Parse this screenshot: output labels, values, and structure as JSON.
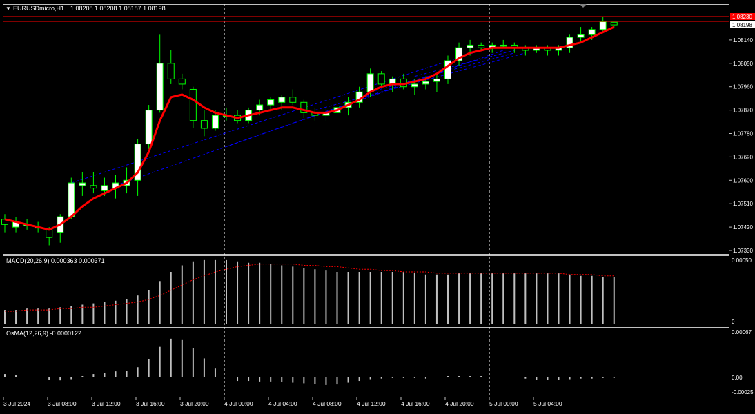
{
  "header": {
    "symbol_label": "EURUSDmicro,H1",
    "ohlc": "1.08208 1.08208 1.08187 1.08198"
  },
  "price_axis": {
    "labels": [
      "1.08230",
      "1.08198",
      "1.08140",
      "1.08050",
      "1.07960",
      "1.07870",
      "1.07780",
      "1.07690",
      "1.07600",
      "1.07510",
      "1.07420",
      "1.07330"
    ],
    "current_price": "1.08198",
    "top_line_price": "1.08230",
    "line_color": "#ff0000"
  },
  "time_axis": {
    "labels": [
      "3 Jul 2024",
      "3 Jul 08:00",
      "3 Jul 12:00",
      "3 Jul 16:00",
      "3 Jul 20:00",
      "4 Jul 00:00",
      "4 Jul 04:00",
      "4 Jul 08:00",
      "4 Jul 12:00",
      "4 Jul 16:00",
      "4 Jul 20:00",
      "5 Jul 00:00",
      "5 Jul 04:00"
    ]
  },
  "macd": {
    "label": "MACD(20,26,9) 0.000363 0.000371",
    "axis_labels": [
      "0.00050",
      "0"
    ]
  },
  "osma": {
    "label": "OsMA(12,26,9) -0.0000122",
    "axis_labels": [
      "0.00067",
      "0.00",
      "-0.00025"
    ]
  },
  "colors": {
    "background": "#000000",
    "bull_candle": "#ffffff",
    "bear_candle": "#000000",
    "candle_outline": "#00ff00",
    "moving_average": "#ff0000",
    "trend_lines": "#0000ff",
    "macd_signal": "#ff0000",
    "histogram": "#c0c0c0"
  },
  "chart_data": [
    {
      "type": "candlestick",
      "title": "EURUSDmicro,H1",
      "ylim": [
        1.0729,
        1.0825
      ],
      "candles": [
        {
          "o": 1.0745,
          "h": 1.0747,
          "l": 1.074,
          "c": 1.0743
        },
        {
          "o": 1.0742,
          "h": 1.0746,
          "l": 1.074,
          "c": 1.0744
        },
        {
          "o": 1.0743,
          "h": 1.0745,
          "l": 1.0741,
          "c": 1.0743
        },
        {
          "o": 1.0742,
          "h": 1.0744,
          "l": 1.074,
          "c": 1.0742
        },
        {
          "o": 1.0741,
          "h": 1.0742,
          "l": 1.0735,
          "c": 1.0738
        },
        {
          "o": 1.074,
          "h": 1.0747,
          "l": 1.0736,
          "c": 1.0746
        },
        {
          "o": 1.0746,
          "h": 1.0761,
          "l": 1.0745,
          "c": 1.0759
        },
        {
          "o": 1.0758,
          "h": 1.0763,
          "l": 1.0754,
          "c": 1.0759
        },
        {
          "o": 1.0758,
          "h": 1.0763,
          "l": 1.0755,
          "c": 1.0757
        },
        {
          "o": 1.0756,
          "h": 1.0761,
          "l": 1.0754,
          "c": 1.0758
        },
        {
          "o": 1.0757,
          "h": 1.0762,
          "l": 1.0753,
          "c": 1.0759
        },
        {
          "o": 1.0758,
          "h": 1.0765,
          "l": 1.0755,
          "c": 1.076
        },
        {
          "o": 1.076,
          "h": 1.0776,
          "l": 1.0754,
          "c": 1.0774
        },
        {
          "o": 1.0774,
          "h": 1.0789,
          "l": 1.0772,
          "c": 1.0787
        },
        {
          "o": 1.0787,
          "h": 1.0816,
          "l": 1.0786,
          "c": 1.0805
        },
        {
          "o": 1.0805,
          "h": 1.081,
          "l": 1.0797,
          "c": 1.0799
        },
        {
          "o": 1.0799,
          "h": 1.0801,
          "l": 1.0795,
          "c": 1.0797
        },
        {
          "o": 1.0795,
          "h": 1.0796,
          "l": 1.078,
          "c": 1.0783
        },
        {
          "o": 1.0783,
          "h": 1.0787,
          "l": 1.0777,
          "c": 1.078
        },
        {
          "o": 1.078,
          "h": 1.0787,
          "l": 1.0779,
          "c": 1.0785
        },
        {
          "o": 1.0785,
          "h": 1.0788,
          "l": 1.0783,
          "c": 1.0785
        },
        {
          "o": 1.0785,
          "h": 1.0787,
          "l": 1.0782,
          "c": 1.0783
        },
        {
          "o": 1.0783,
          "h": 1.0788,
          "l": 1.0782,
          "c": 1.0787
        },
        {
          "o": 1.0787,
          "h": 1.0791,
          "l": 1.0785,
          "c": 1.0789
        },
        {
          "o": 1.0789,
          "h": 1.0792,
          "l": 1.0787,
          "c": 1.0791
        },
        {
          "o": 1.079,
          "h": 1.0793,
          "l": 1.0787,
          "c": 1.0792
        },
        {
          "o": 1.0792,
          "h": 1.0795,
          "l": 1.0789,
          "c": 1.079
        },
        {
          "o": 1.079,
          "h": 1.0791,
          "l": 1.0784,
          "c": 1.0786
        },
        {
          "o": 1.0786,
          "h": 1.0788,
          "l": 1.0783,
          "c": 1.0785
        },
        {
          "o": 1.0785,
          "h": 1.0788,
          "l": 1.0783,
          "c": 1.0786
        },
        {
          "o": 1.0786,
          "h": 1.079,
          "l": 1.0784,
          "c": 1.0788
        },
        {
          "o": 1.0788,
          "h": 1.0792,
          "l": 1.0785,
          "c": 1.079
        },
        {
          "o": 1.079,
          "h": 1.0796,
          "l": 1.0788,
          "c": 1.0794
        },
        {
          "o": 1.0794,
          "h": 1.0803,
          "l": 1.0792,
          "c": 1.0801
        },
        {
          "o": 1.0801,
          "h": 1.0802,
          "l": 1.0796,
          "c": 1.0797
        },
        {
          "o": 1.0797,
          "h": 1.08,
          "l": 1.0794,
          "c": 1.0799
        },
        {
          "o": 1.0799,
          "h": 1.0801,
          "l": 1.0795,
          "c": 1.0796
        },
        {
          "o": 1.0796,
          "h": 1.0799,
          "l": 1.0793,
          "c": 1.0797
        },
        {
          "o": 1.0797,
          "h": 1.08,
          "l": 1.0795,
          "c": 1.0798
        },
        {
          "o": 1.0798,
          "h": 1.0801,
          "l": 1.0794,
          "c": 1.0799
        },
        {
          "o": 1.0799,
          "h": 1.0808,
          "l": 1.0797,
          "c": 1.0806
        },
        {
          "o": 1.0806,
          "h": 1.0813,
          "l": 1.0804,
          "c": 1.0811
        },
        {
          "o": 1.0811,
          "h": 1.0814,
          "l": 1.0808,
          "c": 1.0812
        },
        {
          "o": 1.0812,
          "h": 1.0813,
          "l": 1.081,
          "c": 1.0811
        },
        {
          "o": 1.0811,
          "h": 1.0813,
          "l": 1.0809,
          "c": 1.0812
        },
        {
          "o": 1.0812,
          "h": 1.0814,
          "l": 1.0811,
          "c": 1.0812
        },
        {
          "o": 1.0812,
          "h": 1.0813,
          "l": 1.0809,
          "c": 1.0811
        },
        {
          "o": 1.0811,
          "h": 1.0812,
          "l": 1.0808,
          "c": 1.081
        },
        {
          "o": 1.081,
          "h": 1.0812,
          "l": 1.0809,
          "c": 1.0811
        },
        {
          "o": 1.0811,
          "h": 1.0812,
          "l": 1.0808,
          "c": 1.081
        },
        {
          "o": 1.081,
          "h": 1.0812,
          "l": 1.0808,
          "c": 1.0811
        },
        {
          "o": 1.0811,
          "h": 1.0816,
          "l": 1.0809,
          "c": 1.0815
        },
        {
          "o": 1.0815,
          "h": 1.0819,
          "l": 1.0813,
          "c": 1.0816
        },
        {
          "o": 1.0816,
          "h": 1.0819,
          "l": 1.0814,
          "c": 1.0818
        },
        {
          "o": 1.0818,
          "h": 1.0823,
          "l": 1.0817,
          "c": 1.0821
        },
        {
          "o": 1.08208,
          "h": 1.08208,
          "l": 1.08187,
          "c": 1.08198
        }
      ],
      "moving_average": [
        1.0745,
        1.0744,
        1.0743,
        1.0742,
        1.0741,
        1.0743,
        1.0746,
        1.075,
        1.0753,
        1.0755,
        1.0757,
        1.0759,
        1.0763,
        1.0771,
        1.0783,
        1.0792,
        1.0793,
        1.0791,
        1.0788,
        1.0786,
        1.0785,
        1.0784,
        1.0785,
        1.0786,
        1.0787,
        1.0788,
        1.0788,
        1.0787,
        1.0786,
        1.0786,
        1.0787,
        1.0789,
        1.0791,
        1.0794,
        1.0796,
        1.0797,
        1.0797,
        1.0798,
        1.0799,
        1.0801,
        1.0804,
        1.0807,
        1.0809,
        1.081,
        1.0811,
        1.0811,
        1.0811,
        1.0811,
        1.0811,
        1.0811,
        1.0811,
        1.0812,
        1.0813,
        1.0815,
        1.0817,
        1.0819
      ]
    },
    {
      "type": "bar",
      "title": "MACD(20,26,9) 0.000363 0.000371",
      "ylim": [
        0,
        0.0005
      ],
      "series": [
        {
          "name": "MACD",
          "values": [
            0.00011,
            0.00011,
            0.00012,
            0.00012,
            0.00012,
            0.00013,
            0.00014,
            0.00015,
            0.00016,
            0.00017,
            0.00018,
            0.00019,
            0.00022,
            0.00026,
            0.00033,
            0.0004,
            0.00045,
            0.00048,
            0.00049,
            0.00049,
            0.00049,
            0.00048,
            0.00047,
            0.00047,
            0.00046,
            0.00045,
            0.00044,
            0.00043,
            0.00042,
            0.00041,
            0.0004,
            0.0004,
            0.0004,
            0.0004,
            0.0004,
            0.0004,
            0.0004,
            0.00039,
            0.00038,
            0.00038,
            0.00038,
            0.00039,
            0.00039,
            0.00039,
            0.00039,
            0.00039,
            0.00039,
            0.00039,
            0.00039,
            0.00039,
            0.00039,
            0.00038,
            0.00037,
            0.00037,
            0.00036,
            0.00036
          ]
        },
        {
          "name": "Signal",
          "values": [
            0.0001,
            0.0001,
            0.00011,
            0.00011,
            0.00011,
            0.00012,
            0.00012,
            0.00013,
            0.00013,
            0.00014,
            0.00015,
            0.00016,
            0.00017,
            0.00019,
            0.00022,
            0.00026,
            0.0003,
            0.00034,
            0.00037,
            0.0004,
            0.00042,
            0.00044,
            0.00045,
            0.00046,
            0.00046,
            0.00046,
            0.00046,
            0.00045,
            0.00045,
            0.00044,
            0.00044,
            0.00043,
            0.00042,
            0.00042,
            0.00041,
            0.00041,
            0.0004,
            0.0004,
            0.0004,
            0.00039,
            0.00039,
            0.00039,
            0.00039,
            0.00039,
            0.00039,
            0.00039,
            0.00039,
            0.00039,
            0.00039,
            0.00039,
            0.00039,
            0.00038,
            0.00038,
            0.00038,
            0.00037,
            0.00037
          ]
        }
      ]
    },
    {
      "type": "bar",
      "title": "OsMA(12,26,9) -0.0000122",
      "ylim": [
        -0.00025,
        0.00067
      ],
      "series": [
        {
          "name": "OsMA",
          "values": [
            5e-05,
            3e-05,
            1e-05,
            0.0,
            -4e-05,
            -5e-05,
            -3e-05,
            2e-05,
            5e-05,
            7e-05,
            9e-05,
            0.0001,
            0.00015,
            0.00027,
            0.00045,
            0.00057,
            0.00055,
            0.00043,
            0.00028,
            0.00013,
            1e-05,
            -6e-05,
            -6e-05,
            -7e-05,
            -7e-05,
            -8e-05,
            -9e-05,
            -0.0001,
            -0.00011,
            -0.00013,
            -0.00012,
            -9e-05,
            -6e-05,
            -3e-05,
            -2e-05,
            -1e-05,
            -1e-05,
            -1e-05,
            -2e-05,
            0.0,
            2e-05,
            2e-05,
            2e-05,
            2e-05,
            1e-05,
            1e-05,
            0.0,
            -2e-05,
            -4e-05,
            -4e-05,
            -4e-05,
            -3e-05,
            -2e-05,
            -2e-05,
            -1e-05,
            -1e-05
          ]
        }
      ]
    }
  ]
}
